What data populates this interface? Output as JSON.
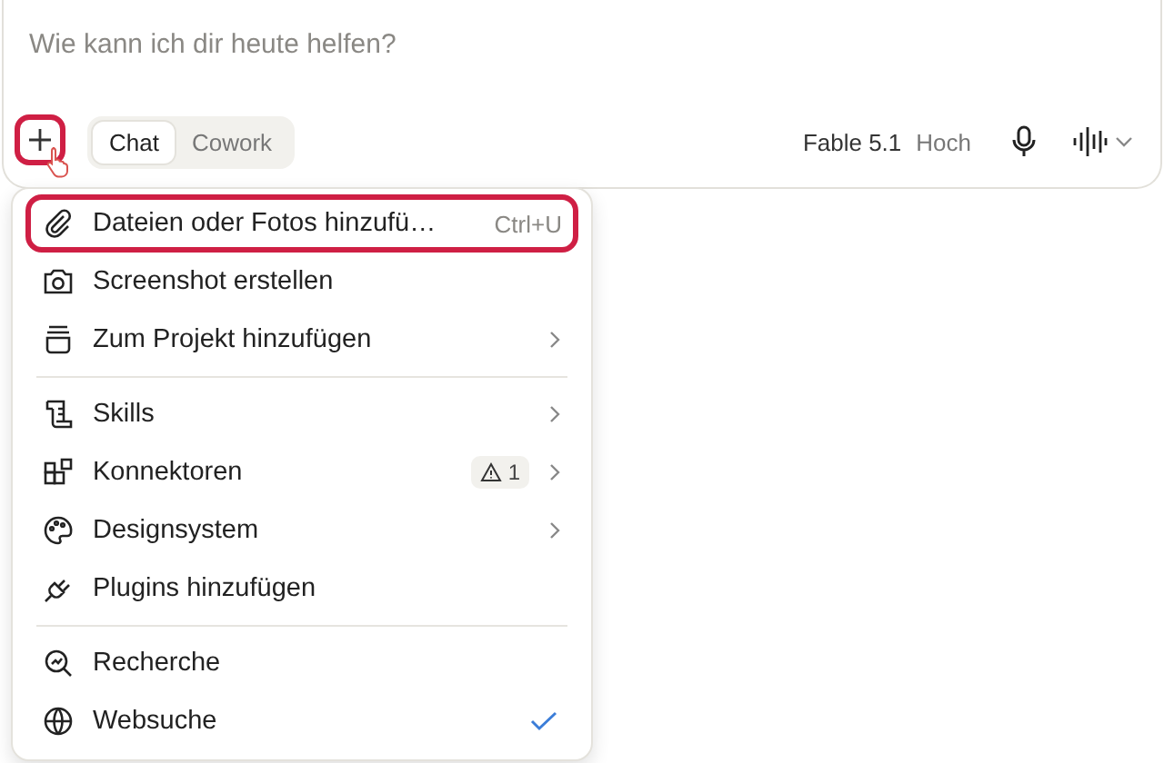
{
  "composer": {
    "placeholder": "Wie kann ich dir heute helfen?",
    "add_button_highlighted": true,
    "modes": [
      {
        "label": "Chat",
        "selected": true
      },
      {
        "label": "Cowork",
        "selected": false
      }
    ],
    "model": "Fable 5.1",
    "effort": "Hoch"
  },
  "menu": {
    "groups": [
      [
        {
          "label": "Dateien oder Fotos hinzufü…",
          "shortcut": "Ctrl+U",
          "submenu": false,
          "checked": false,
          "highlighted": true
        },
        {
          "label": "Screenshot erstellen",
          "submenu": false,
          "checked": false,
          "highlighted": false
        },
        {
          "label": "Zum Projekt hinzufügen",
          "submenu": true,
          "checked": false,
          "highlighted": false
        }
      ],
      [
        {
          "label": "Skills",
          "submenu": true,
          "checked": false,
          "highlighted": false
        },
        {
          "label": "Konnektoren",
          "badge": "1",
          "submenu": true,
          "checked": false,
          "highlighted": false
        },
        {
          "label": "Designsystem",
          "submenu": true,
          "checked": false,
          "highlighted": false
        },
        {
          "label": "Plugins hinzufügen",
          "submenu": false,
          "checked": false,
          "highlighted": false
        }
      ],
      [
        {
          "label": "Recherche",
          "submenu": false,
          "checked": false,
          "highlighted": false
        },
        {
          "label": "Websuche",
          "submenu": false,
          "checked": true,
          "highlighted": false
        }
      ]
    ]
  }
}
